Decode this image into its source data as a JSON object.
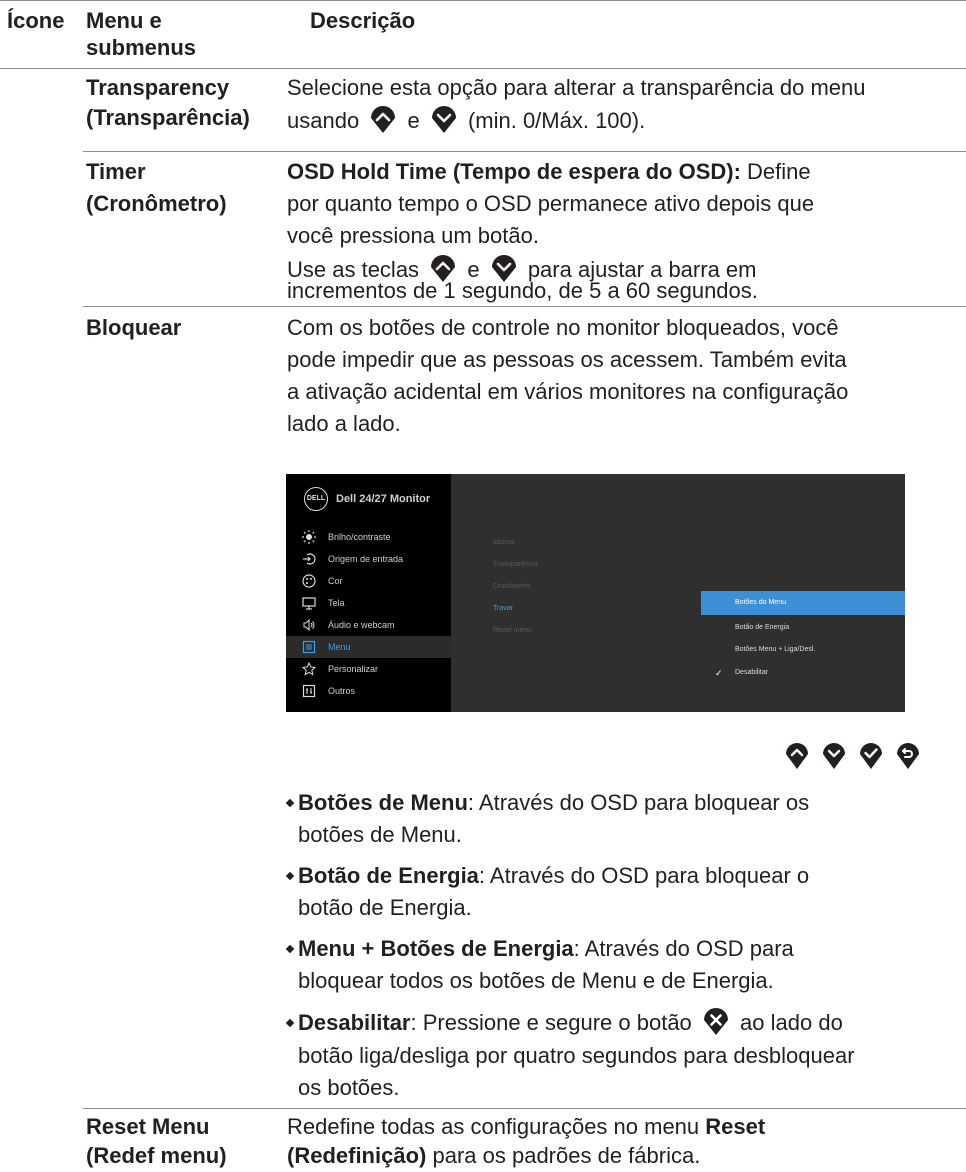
{
  "header": {
    "col_icon": "Ícone",
    "col_menu_line1": "Menu e",
    "col_menu_line2": "submenus",
    "col_desc": "Descrição"
  },
  "rows": {
    "transparency": {
      "label_line1": "Transparency",
      "label_line2": "(Transparência)",
      "desc_line1": "Selecione esta opção para alterar a transparência do menu",
      "desc_line2_a": "usando",
      "desc_line2_b": "e",
      "desc_line2_c": "(min. 0/Máx. 100)."
    },
    "timer": {
      "label_line1": "Timer",
      "label_line2": "(Cronômetro)",
      "desc_bold": "OSD Hold Time (Tempo de espera do OSD):",
      "desc_line1_rest": "Define",
      "desc_line2": "por quanto tempo o OSD permanece ativo depois que",
      "desc_line3": "você pressiona um botão.",
      "desc2_line1_a": "Use as teclas",
      "desc2_line1_b": "e",
      "desc2_line1_c": "para ajustar a barra em",
      "desc2_line2": "incrementos de 1 segundo, de 5 a 60 segundos."
    },
    "lock": {
      "label": "Bloquear",
      "desc_line1": "Com os botões de controle no monitor bloqueados, você",
      "desc_line2": "pode impedir que as pessoas os acessem. Também evita",
      "desc_line3": "a ativação acidental em vários monitores na configuração",
      "desc_line4": "lado a lado.",
      "bullets": [
        {
          "bold": "Botões de Menu",
          "rest1": ": Através do OSD para bloquear os",
          "rest2": "botões de Menu."
        },
        {
          "bold": "Botão de Energia",
          "rest1": ": Através do OSD para bloquear o",
          "rest2": "botão de Energia."
        },
        {
          "bold": "Menu + Botões de Energia",
          "rest1": ": Através do OSD para",
          "rest2": "bloquear todos os botões de Menu e de Energia."
        },
        {
          "bold": "Desabilitar",
          "rest1a": ": Pressione e segure o botão",
          "rest1b": "ao lado do",
          "rest2": "botão liga/desliga por quatro segundos para desbloquear",
          "rest3": "os botões."
        }
      ]
    },
    "reset": {
      "label_line1": "Reset Menu",
      "label_line2": "(Redef menu)",
      "desc_line1_a": "Redefine todas as configurações no menu",
      "desc_line1_b": "Reset",
      "desc_line2_a": "(Redefinição)",
      "desc_line2_b": "para os padrões de fábrica."
    }
  },
  "osd": {
    "logo": "DELL",
    "title": "Dell 24/27 Monitor",
    "menu": [
      "Brilho/contraste",
      "Origem de entrada",
      "Cor",
      "Tela",
      "Áudio e webcam",
      "Menu",
      "Personalizar",
      "Outros"
    ],
    "active_menu": "Menu",
    "submenu": [
      "Idioma",
      "Transparência",
      "Cronômetro",
      "Travar",
      "Redef menu"
    ],
    "selected_submenu": "Travar",
    "options": [
      "Botões do Menu",
      "Botão de Energia",
      "Botões Menu + Liga/Desl.",
      "Desabilitar"
    ],
    "highlighted_option": "Botões do Menu",
    "checked_option": "Desabilitar"
  },
  "colors": {
    "text": "#231f20",
    "rule": "#8c8c8c",
    "osd_accent": "#3d8fd6",
    "osd_bg": "#2f2f2f"
  }
}
